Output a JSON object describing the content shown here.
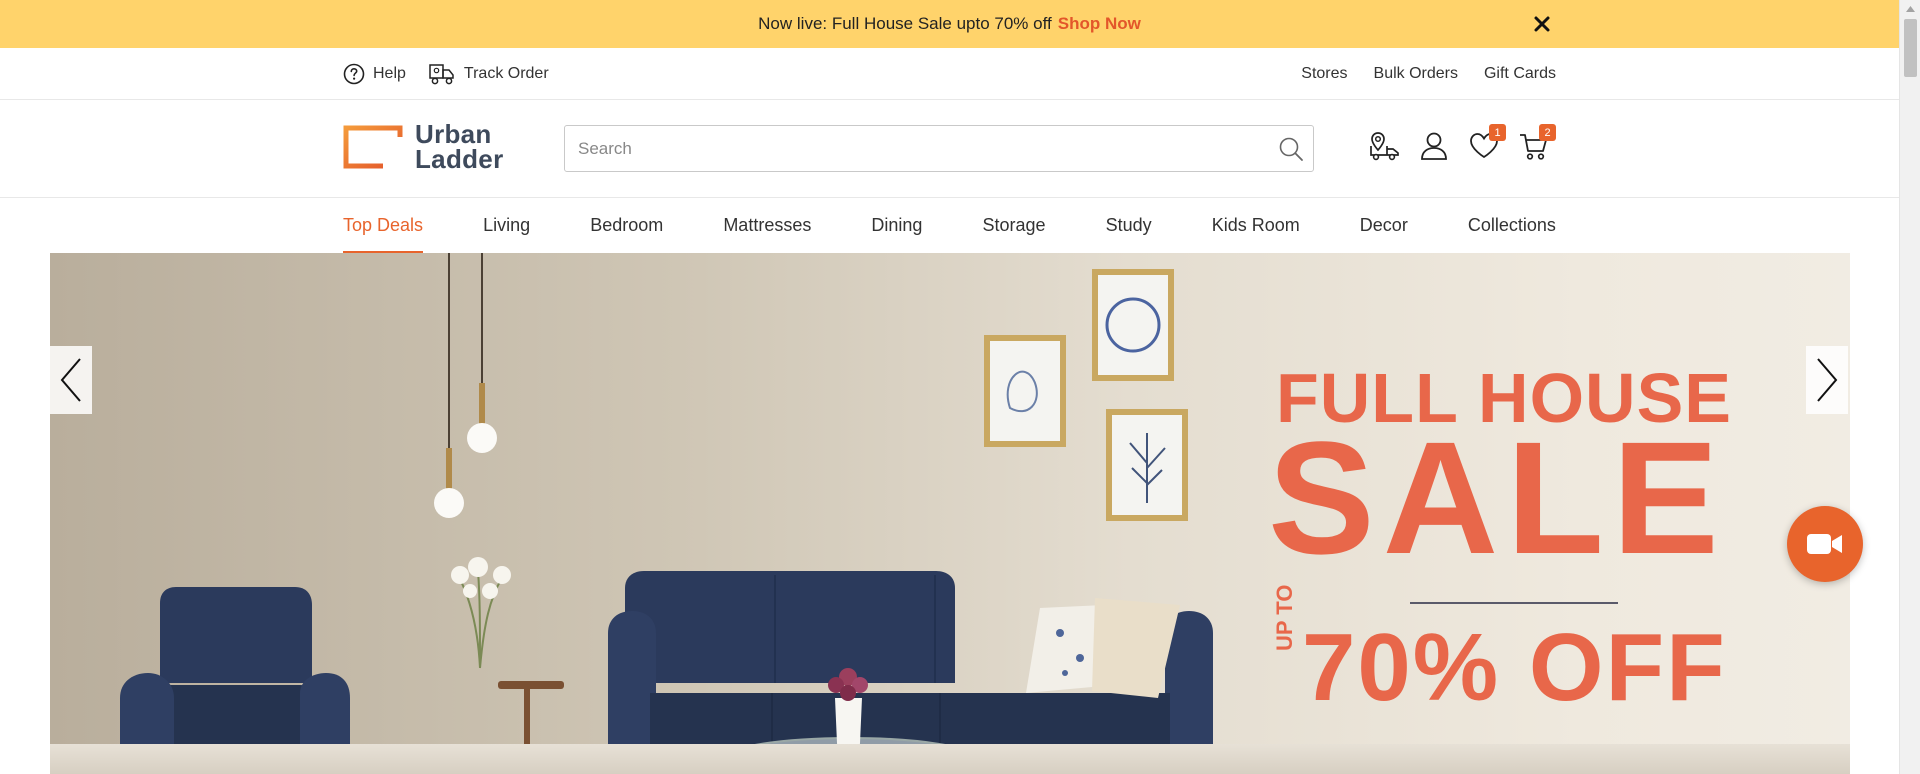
{
  "announcement": {
    "text": "Now live: Full House Sale upto 70% off",
    "link": "Shop Now"
  },
  "utility": {
    "left": [
      {
        "label": "Help",
        "icon": "help-circle-icon"
      },
      {
        "label": "Track Order",
        "icon": "delivery-truck-icon"
      }
    ],
    "right": [
      "Stores",
      "Bulk Orders",
      "Gift Cards"
    ]
  },
  "header": {
    "logo": {
      "line1": "Urban",
      "line2": "Ladder"
    },
    "search": {
      "placeholder": "Search",
      "value": ""
    },
    "icons": [
      {
        "name": "delivery-truck-icon",
        "badge": ""
      },
      {
        "name": "user-icon",
        "badge": ""
      },
      {
        "name": "heart-icon",
        "badge": "1"
      },
      {
        "name": "cart-icon",
        "badge": "2"
      }
    ]
  },
  "nav": {
    "items": [
      "Top Deals",
      "Living",
      "Bedroom",
      "Mattresses",
      "Dining",
      "Storage",
      "Study",
      "Kids Room",
      "Decor",
      "Collections"
    ],
    "active": "Top Deals"
  },
  "hero": {
    "line1": "FULL HOUSE",
    "line2": "SALE",
    "upto": "UP TO",
    "line3": "70% OFF"
  },
  "colors": {
    "accent": "#e8642c",
    "banner": "#ffd36b",
    "sofa": "#2b3a5c",
    "sale_text": "#e8674a"
  }
}
